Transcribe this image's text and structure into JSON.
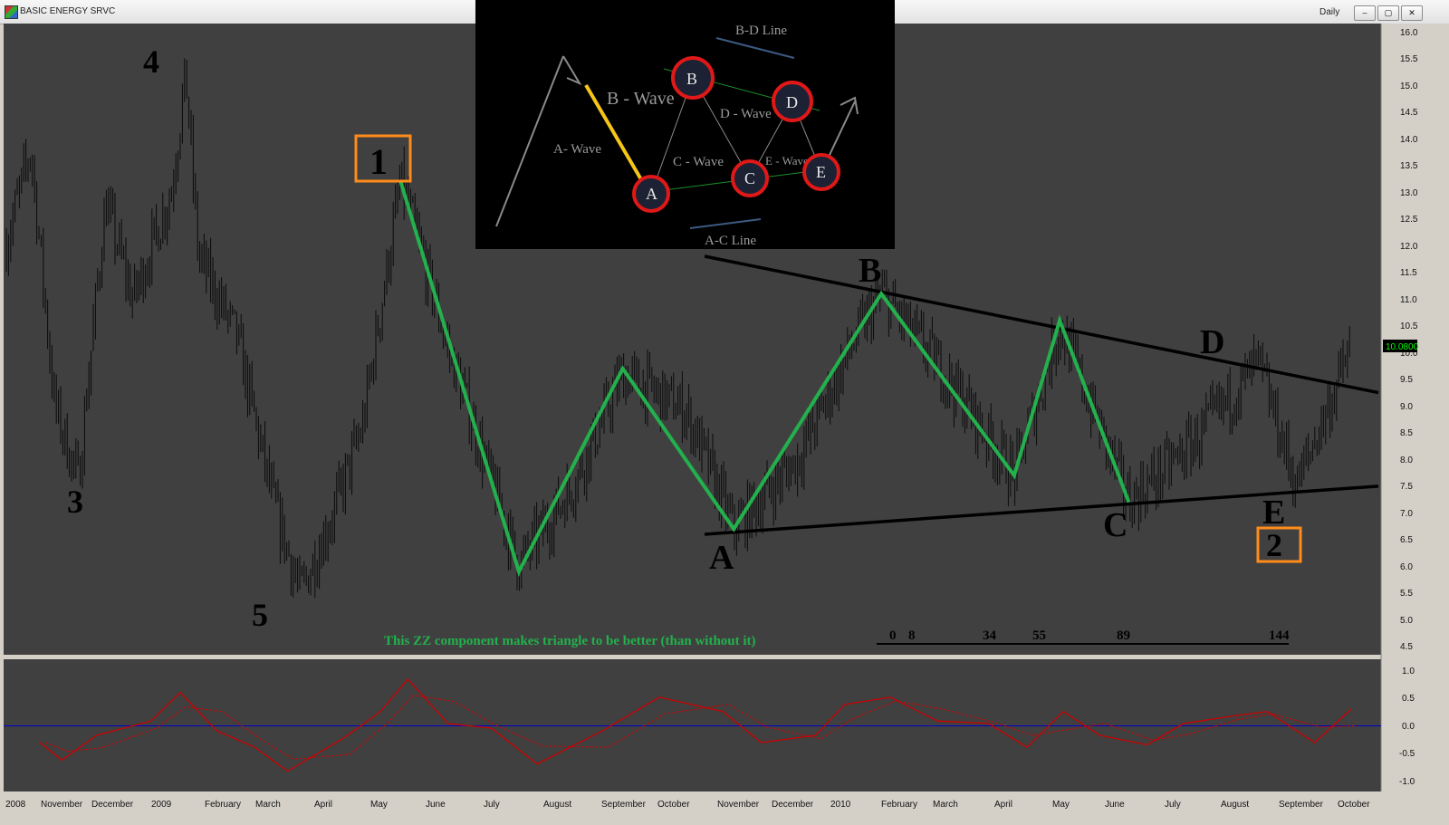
{
  "window": {
    "title": "BASIC ENERGY SRVC",
    "period": "Daily",
    "buttons": {
      "minimize": "–",
      "restore": "▢",
      "close": "✕"
    }
  },
  "colors": {
    "chart_bg": "#404040",
    "zigzag": "#22b14c",
    "trendline": "#000000",
    "price_badge": "#000000",
    "price_badge_text": "#00ff00",
    "oscillator": "#cc0000",
    "zero_line": "#0000cc",
    "box": "#ff8c1a"
  },
  "price_axis": {
    "ticks": [
      "16.0",
      "15.5",
      "15.0",
      "14.5",
      "14.0",
      "13.5",
      "13.0",
      "12.5",
      "12.0",
      "11.5",
      "11.0",
      "10.5",
      "10.0",
      "9.5",
      "9.0",
      "8.5",
      "8.0",
      "7.5",
      "7.0",
      "6.5",
      "6.0",
      "5.5",
      "5.0",
      "4.5"
    ],
    "current_price": "10.0800"
  },
  "osc_axis": {
    "ticks": [
      "1.0",
      "0.5",
      "0.0",
      "-0.5",
      "-1.0"
    ]
  },
  "time_axis": {
    "months": [
      "2008",
      "November",
      "December",
      "2009",
      "February",
      "March",
      "April",
      "May",
      "June",
      "July",
      "August",
      "September",
      "October",
      "November",
      "December",
      "2010",
      "February",
      "March",
      "April",
      "May",
      "June",
      "July",
      "August",
      "September",
      "October"
    ]
  },
  "wave_labels": {
    "n1": "1",
    "n2": "2",
    "n3": "3",
    "n4": "4",
    "n5": "5",
    "a": "A",
    "b": "B",
    "c": "C",
    "d": "D",
    "e": "E"
  },
  "fib_counts": [
    "0",
    "8",
    "34",
    "55",
    "89",
    "144"
  ],
  "annotation": "This ZZ component makes triangle to be better (than without it)",
  "inset": {
    "bd_line": "B-D Line",
    "ac_line": "A-C Line",
    "a_wave": "A- Wave",
    "b_wave": "B - Wave",
    "c_wave": "C - Wave",
    "d_wave": "D - Wave",
    "e_wave": "E - Wave",
    "nodes": [
      "A",
      "B",
      "C",
      "D",
      "E"
    ]
  },
  "chart_data": {
    "type": "candlestick",
    "title": "BASIC ENERGY SRVC",
    "interval": "Daily",
    "y_range": [
      4.3,
      16.2
    ],
    "oscillator_range": [
      -1.15,
      1.15
    ],
    "current_price": 10.08,
    "price_path": [
      {
        "x": "2008-10-01",
        "y": 12.0
      },
      {
        "x": "2008-10-15",
        "y": 13.8
      },
      {
        "x": "2008-10-28",
        "y": 9.0
      },
      {
        "x": "2008-11-10",
        "y": 7.6
      },
      {
        "x": "2008-11-25",
        "y": 12.8
      },
      {
        "x": "2008-12-10",
        "y": 11.0
      },
      {
        "x": "2008-12-31",
        "y": 13.0
      },
      {
        "x": "2009-01-08",
        "y": 15.2
      },
      {
        "x": "2009-01-15",
        "y": 11.8
      },
      {
        "x": "2009-02-05",
        "y": 10.3
      },
      {
        "x": "2009-02-25",
        "y": 7.2
      },
      {
        "x": "2009-03-12",
        "y": 5.5
      },
      {
        "x": "2009-03-30",
        "y": 7.0
      },
      {
        "x": "2009-04-15",
        "y": 8.6
      },
      {
        "x": "2009-05-06",
        "y": 13.2
      },
      {
        "x": "2009-06-01",
        "y": 10.1
      },
      {
        "x": "2009-07-10",
        "y": 6.0
      },
      {
        "x": "2009-08-10",
        "y": 7.6
      },
      {
        "x": "2009-09-05",
        "y": 9.6
      },
      {
        "x": "2009-10-10",
        "y": 8.9
      },
      {
        "x": "2009-11-05",
        "y": 6.7
      },
      {
        "x": "2009-12-10",
        "y": 8.0
      },
      {
        "x": "2010-01-10",
        "y": 10.2
      },
      {
        "x": "2010-01-25",
        "y": 11.1
      },
      {
        "x": "2010-03-01",
        "y": 9.6
      },
      {
        "x": "2010-04-08",
        "y": 7.7
      },
      {
        "x": "2010-05-03",
        "y": 10.5
      },
      {
        "x": "2010-06-10",
        "y": 7.2
      },
      {
        "x": "2010-07-15",
        "y": 8.3
      },
      {
        "x": "2010-08-20",
        "y": 9.8
      },
      {
        "x": "2010-09-10",
        "y": 7.5
      },
      {
        "x": "2010-10-10",
        "y": 10.08
      }
    ],
    "zigzag": [
      {
        "x": "2009-05-06",
        "y": 13.2
      },
      {
        "x": "2009-07-10",
        "y": 5.9
      },
      {
        "x": "2009-09-05",
        "y": 9.7
      },
      {
        "x": "2009-11-05",
        "y": 6.7
      },
      {
        "x": "2010-01-25",
        "y": 11.1
      },
      {
        "x": "2010-04-08",
        "y": 7.7
      },
      {
        "x": "2010-05-03",
        "y": 10.6
      },
      {
        "x": "2010-06-10",
        "y": 7.2
      }
    ],
    "trendlines": [
      {
        "name": "upper",
        "from": {
          "x": "2009-10-20",
          "y": 11.8
        },
        "to": {
          "x": "2010-10-25",
          "y": 9.25
        }
      },
      {
        "name": "lower",
        "from": {
          "x": "2009-10-20",
          "y": 6.6
        },
        "to": {
          "x": "2010-10-25",
          "y": 7.5
        }
      }
    ],
    "oscillator": [
      {
        "x": "2008-10-20",
        "y": -0.35
      },
      {
        "x": "2008-11-01",
        "y": -0.72
      },
      {
        "x": "2008-11-20",
        "y": -0.2
      },
      {
        "x": "2008-12-20",
        "y": 0.1
      },
      {
        "x": "2009-01-05",
        "y": 0.7
      },
      {
        "x": "2009-01-25",
        "y": -0.1
      },
      {
        "x": "2009-02-15",
        "y": -0.45
      },
      {
        "x": "2009-03-05",
        "y": -0.95
      },
      {
        "x": "2009-04-05",
        "y": -0.25
      },
      {
        "x": "2009-04-25",
        "y": 0.3
      },
      {
        "x": "2009-05-10",
        "y": 0.98
      },
      {
        "x": "2009-06-01",
        "y": 0.05
      },
      {
        "x": "2009-06-25",
        "y": -0.05
      },
      {
        "x": "2009-07-20",
        "y": -0.8
      },
      {
        "x": "2009-08-25",
        "y": -0.1
      },
      {
        "x": "2009-09-25",
        "y": 0.6
      },
      {
        "x": "2009-10-30",
        "y": 0.3
      },
      {
        "x": "2009-11-20",
        "y": -0.35
      },
      {
        "x": "2009-12-20",
        "y": -0.2
      },
      {
        "x": "2010-01-05",
        "y": 0.45
      },
      {
        "x": "2010-01-30",
        "y": 0.6
      },
      {
        "x": "2010-02-25",
        "y": 0.1
      },
      {
        "x": "2010-03-25",
        "y": 0.05
      },
      {
        "x": "2010-04-15",
        "y": -0.45
      },
      {
        "x": "2010-05-05",
        "y": 0.3
      },
      {
        "x": "2010-05-25",
        "y": -0.2
      },
      {
        "x": "2010-06-20",
        "y": -0.4
      },
      {
        "x": "2010-07-10",
        "y": 0.05
      },
      {
        "x": "2010-08-05",
        "y": 0.2
      },
      {
        "x": "2010-08-25",
        "y": 0.3
      },
      {
        "x": "2010-09-20",
        "y": -0.35
      },
      {
        "x": "2010-10-10",
        "y": 0.35
      }
    ]
  }
}
